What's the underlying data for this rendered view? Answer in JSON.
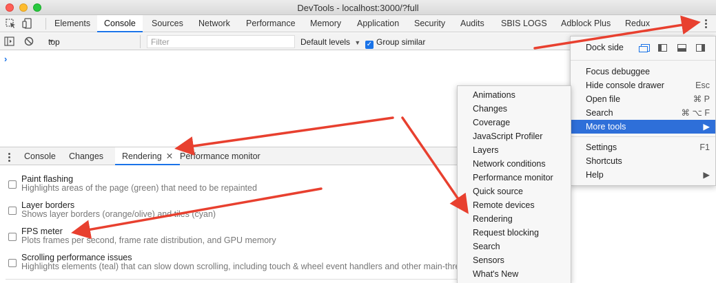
{
  "window": {
    "title": "DevTools - localhost:3000/?full"
  },
  "tabs": [
    "Elements",
    "Console",
    "Sources",
    "Network",
    "Performance",
    "Memory",
    "Application",
    "Security",
    "Audits",
    "SBIS LOGS",
    "Adblock Plus",
    "Redux"
  ],
  "active_tab": "Console",
  "console_toolbar": {
    "context": "top",
    "filter_placeholder": "Filter",
    "levels": "Default levels",
    "group_similar": "Group similar"
  },
  "drawer": {
    "tabs": [
      "Console",
      "Changes",
      "Rendering",
      "Performance monitor"
    ],
    "active_tab": "Rendering",
    "options": [
      {
        "title": "Paint flashing",
        "desc": "Highlights areas of the page (green) that need to be repainted"
      },
      {
        "title": "Layer borders",
        "desc": "Shows layer borders (orange/olive) and tiles (cyan)"
      },
      {
        "title": "FPS meter",
        "desc": "Plots frames per second, frame rate distribution, and GPU memory"
      },
      {
        "title": "Scrolling performance issues",
        "desc": "Highlights elements (teal) that can slow down scrolling, including touch & wheel event handlers and other main-thread"
      }
    ]
  },
  "main_menu": {
    "dock_side_label": "Dock side",
    "items": [
      {
        "label": "Focus debuggee",
        "shortcut": ""
      },
      {
        "label": "Hide console drawer",
        "shortcut": "Esc"
      },
      {
        "label": "Open file",
        "shortcut": "⌘ P"
      },
      {
        "label": "Search",
        "shortcut": "⌘ ⌥ F"
      },
      {
        "label": "More tools",
        "shortcut": "▶"
      },
      {
        "label": "Settings",
        "shortcut": "F1"
      },
      {
        "label": "Shortcuts",
        "shortcut": ""
      },
      {
        "label": "Help",
        "shortcut": "▶"
      }
    ]
  },
  "more_tools_menu": {
    "items": [
      "Animations",
      "Changes",
      "Coverage",
      "JavaScript Profiler",
      "Layers",
      "Network conditions",
      "Performance monitor",
      "Quick source",
      "Remote devices",
      "Rendering",
      "Request blocking",
      "Search",
      "Sensors",
      "What's New"
    ]
  },
  "colors": {
    "accent": "#1a73e8",
    "highlight": "#2e6fd9",
    "arrow": "#e8402f"
  }
}
